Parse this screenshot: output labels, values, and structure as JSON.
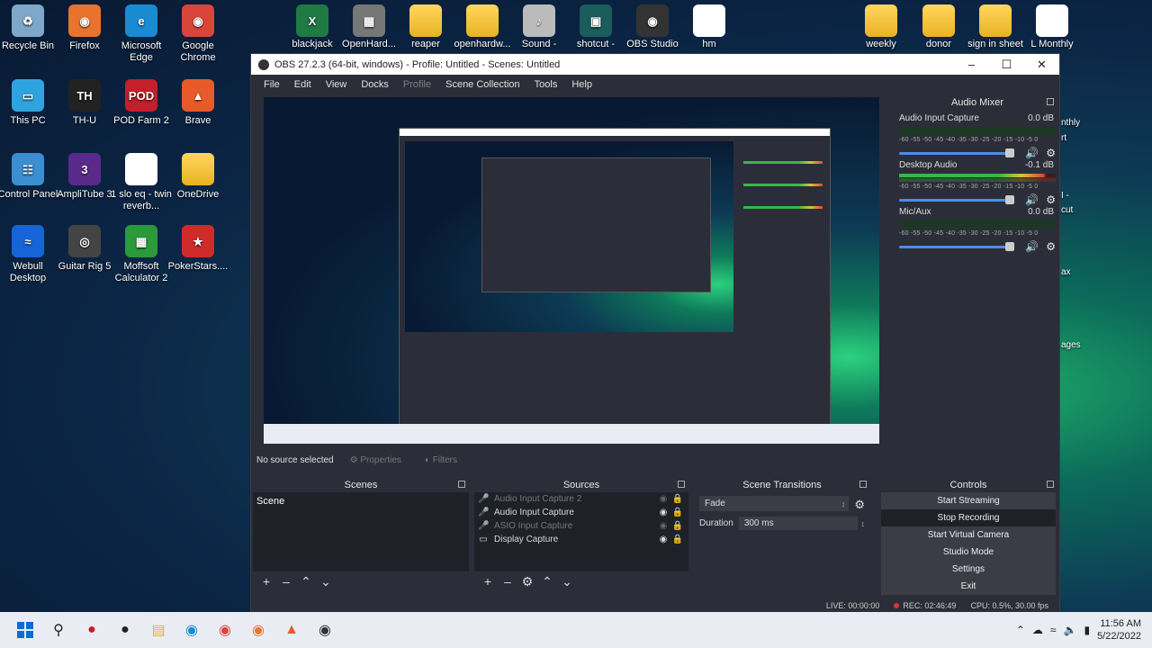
{
  "desktop": {
    "left_icons": [
      {
        "label": "Recycle Bin",
        "icon": "recycle-bin-icon"
      },
      {
        "label": "Firefox",
        "icon": "firefox-icon"
      },
      {
        "label": "Microsoft Edge",
        "icon": "edge-icon"
      },
      {
        "label": "Google Chrome",
        "icon": "chrome-icon"
      },
      {
        "label": "This PC",
        "icon": "monitor-icon"
      },
      {
        "label": "TH-U",
        "icon": "thu-icon"
      },
      {
        "label": "POD Farm 2",
        "icon": "podfarm-icon"
      },
      {
        "label": "Brave",
        "icon": "brave-icon"
      },
      {
        "label": "Control Panel",
        "icon": "control-panel-icon"
      },
      {
        "label": "AmpliTube 3",
        "icon": "amplitube-icon"
      },
      {
        "label": "1 slo eq - twin reverb...",
        "icon": "file-icon"
      },
      {
        "label": "OneDrive",
        "icon": "onedrive-folder-icon"
      },
      {
        "label": "Webull Desktop",
        "icon": "webull-icon"
      },
      {
        "label": "Guitar Rig 5",
        "icon": "guitar-rig-icon"
      },
      {
        "label": "Moffsoft Calculator 2",
        "icon": "calculator-icon"
      },
      {
        "label": "PokerStars....",
        "icon": "pokerstars-icon"
      }
    ],
    "top_icons": [
      {
        "label": "blackjack",
        "icon": "excel-icon"
      },
      {
        "label": "OpenHard...",
        "icon": "openhardware-icon"
      },
      {
        "label": "reaper",
        "icon": "folder-icon"
      },
      {
        "label": "openhardw...",
        "icon": "folder-icon"
      },
      {
        "label": "Sound -",
        "icon": "sound-icon"
      },
      {
        "label": "shotcut -",
        "icon": "shotcut-icon"
      },
      {
        "label": "OBS Studio",
        "icon": "obs-icon"
      },
      {
        "label": "hm",
        "icon": "file-icon"
      },
      {
        "label": "weekly",
        "icon": "folder-icon"
      },
      {
        "label": "donor",
        "icon": "folder-icon"
      },
      {
        "label": "sign in sheet",
        "icon": "folder-icon"
      },
      {
        "label": "L Monthly",
        "icon": "document-icon"
      }
    ],
    "right_edge_labels": [
      "nthly",
      "rt",
      "I -",
      "cut",
      "ax",
      "ages"
    ]
  },
  "obs": {
    "title": "OBS 27.2.3 (64-bit, windows) - Profile: Untitled - Scenes: Untitled",
    "menu": [
      "File",
      "Edit",
      "View",
      "Docks",
      "Profile",
      "Scene Collection",
      "Tools",
      "Help"
    ],
    "audio_mixer": {
      "title": "Audio Mixer",
      "ticks": "-60 -55 -50 -45 -40 -35 -30 -25 -20 -15 -10 -5 0",
      "channels": [
        {
          "name": "Audio Input Capture",
          "db": "0.0 dB",
          "level": 0.0
        },
        {
          "name": "Desktop Audio",
          "db": "-0.1 dB",
          "level": 0.93
        },
        {
          "name": "Mic/Aux",
          "db": "0.0 dB",
          "level": 0.0
        }
      ]
    },
    "source_bar": {
      "no_source": "No source selected",
      "properties": "Properties",
      "filters": "Filters"
    },
    "scenes": {
      "title": "Scenes",
      "items": [
        "Scene"
      ]
    },
    "sources": {
      "title": "Sources",
      "items": [
        {
          "label": "Audio Input Capture 2",
          "icon": "microphone-icon",
          "visible": false
        },
        {
          "label": "Audio Input Capture",
          "icon": "microphone-icon",
          "visible": true
        },
        {
          "label": "ASIO Input Capture",
          "icon": "microphone-icon",
          "visible": false
        },
        {
          "label": "Display Capture",
          "icon": "monitor-icon",
          "visible": true
        }
      ]
    },
    "transitions": {
      "title": "Scene Transitions",
      "selected": "Fade",
      "duration_label": "Duration",
      "duration_value": "300 ms"
    },
    "controls": {
      "title": "Controls",
      "buttons": [
        "Start Streaming",
        "Stop Recording",
        "Start Virtual Camera",
        "Studio Mode",
        "Settings",
        "Exit"
      ]
    },
    "status": {
      "live": "LIVE: 00:00:00",
      "rec": "REC: 02:46:49",
      "cpu": "CPU: 0.5%, 30.00 fps"
    }
  },
  "taskbar": {
    "apps": [
      "windows-start-icon",
      "search-icon",
      "podfarm-icon",
      "thu-icon",
      "file-explorer-icon",
      "edge-icon",
      "chrome-icon",
      "firefox-icon",
      "brave-icon",
      "obs-icon"
    ],
    "time": "11:56 AM",
    "date": "5/22/2022"
  }
}
